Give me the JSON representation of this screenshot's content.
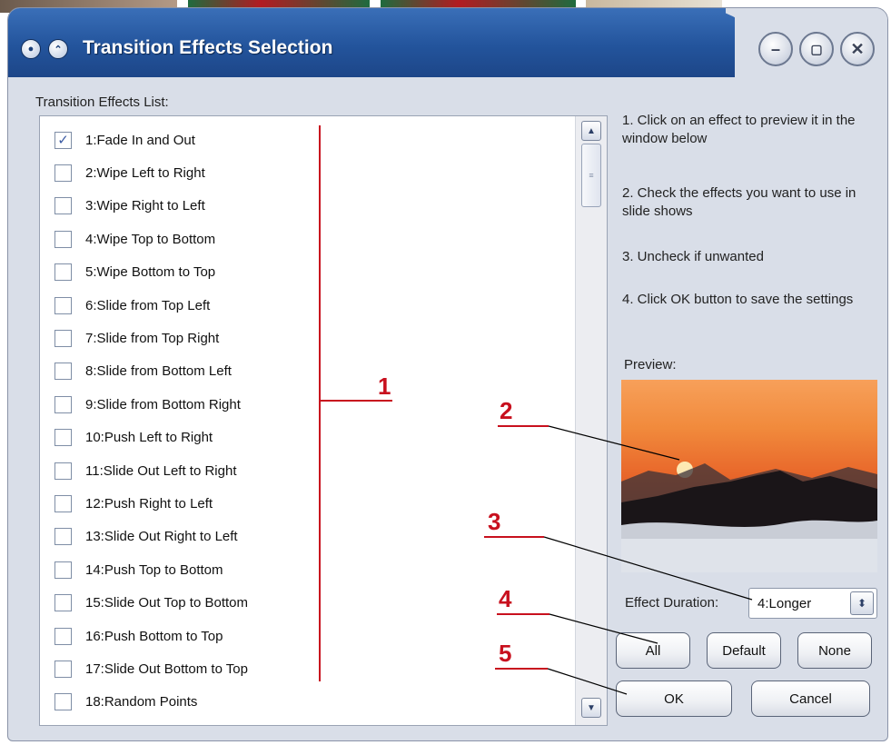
{
  "window": {
    "title": "Transition Effects Selection",
    "accent": "#23549c"
  },
  "list": {
    "label": "Transition Effects List:",
    "items": [
      {
        "label": "1:Fade In and Out",
        "checked": true
      },
      {
        "label": "2:Wipe Left to Right",
        "checked": false
      },
      {
        "label": "3:Wipe Right to Left",
        "checked": false
      },
      {
        "label": "4:Wipe Top to Bottom",
        "checked": false
      },
      {
        "label": "5:Wipe Bottom to Top",
        "checked": false
      },
      {
        "label": "6:Slide from Top Left",
        "checked": false
      },
      {
        "label": "7:Slide from Top Right",
        "checked": false
      },
      {
        "label": "8:Slide from Bottom Left",
        "checked": false
      },
      {
        "label": "9:Slide from Bottom Right",
        "checked": false
      },
      {
        "label": "10:Push Left to Right",
        "checked": false
      },
      {
        "label": "11:Slide Out Left to Right",
        "checked": false
      },
      {
        "label": "12:Push Right to Left",
        "checked": false
      },
      {
        "label": "13:Slide Out Right to Left",
        "checked": false
      },
      {
        "label": "14:Push Top to Bottom",
        "checked": false
      },
      {
        "label": "15:Slide Out Top to Bottom",
        "checked": false
      },
      {
        "label": "16:Push Bottom to Top",
        "checked": false
      },
      {
        "label": "17:Slide Out Bottom to Top",
        "checked": false
      },
      {
        "label": "18:Random Points",
        "checked": false
      }
    ]
  },
  "instructions": [
    "1. Click on an effect to preview it in the window below",
    "2. Check the effects you want to use in slide shows",
    "3. Uncheck if unwanted",
    "4. Click OK button to save the settings"
  ],
  "preview": {
    "label": "Preview:"
  },
  "duration": {
    "label": "Effect Duration:",
    "value": "4:Longer"
  },
  "buttons": {
    "all": "All",
    "default": "Default",
    "none": "None",
    "ok": "OK",
    "cancel": "Cancel"
  },
  "annotations": {
    "color": "#c8101e",
    "numbers": [
      "1",
      "2",
      "3",
      "4",
      "5"
    ]
  }
}
